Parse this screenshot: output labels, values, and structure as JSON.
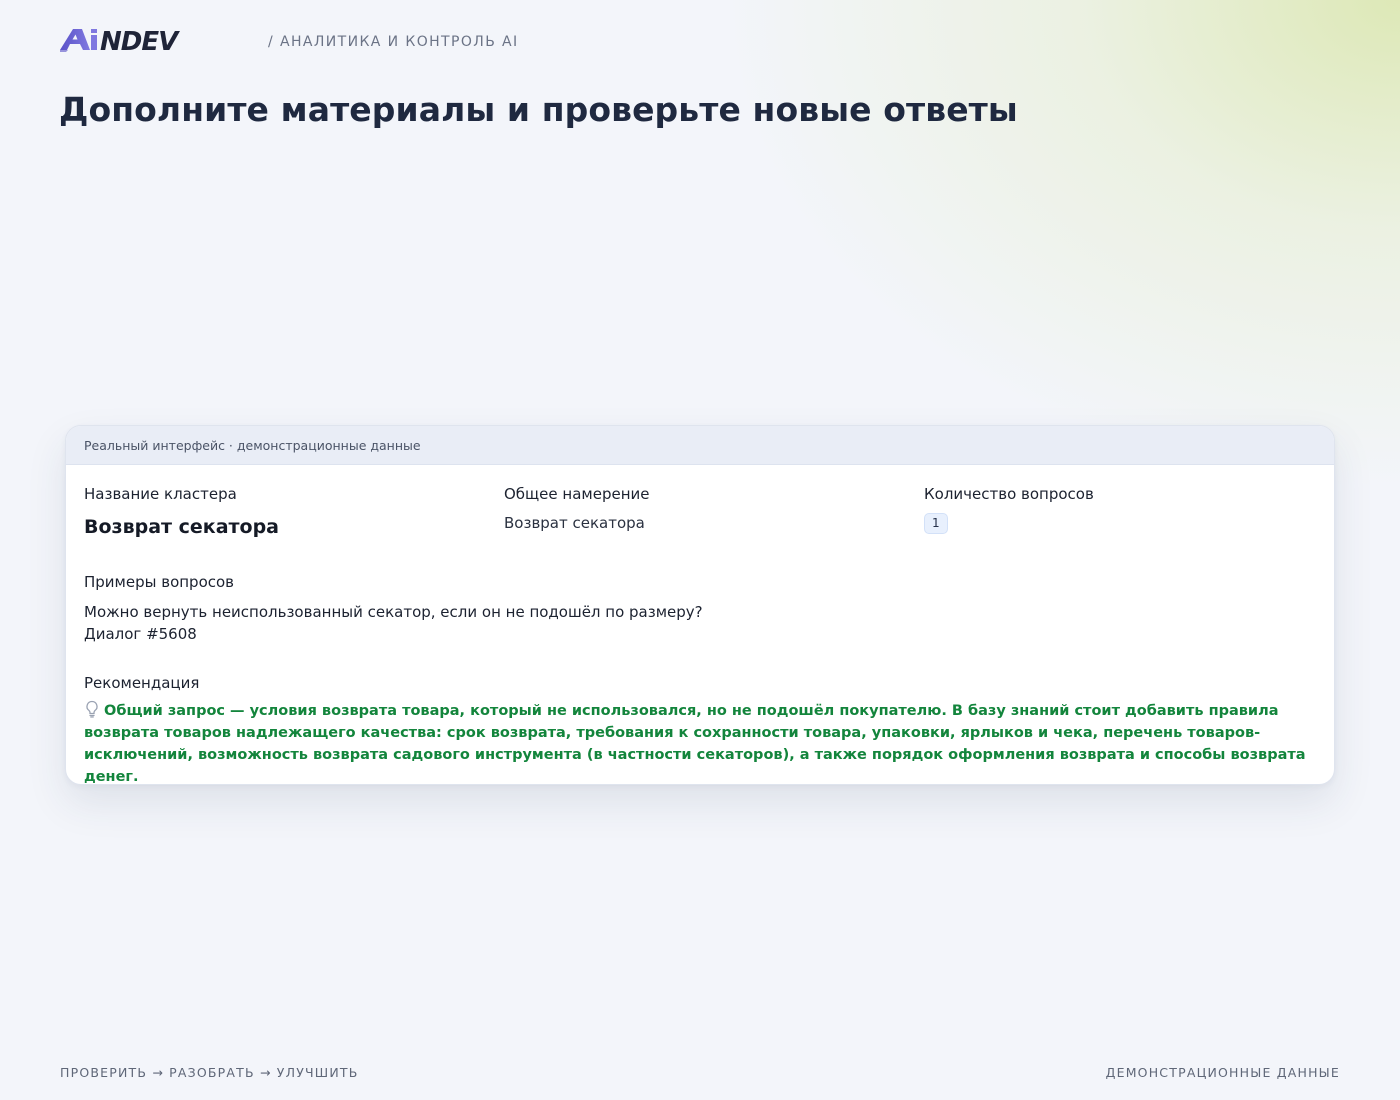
{
  "brand": {
    "logo_text": "AiNDEV",
    "subtitle": "/ АНАЛИТИКА И КОНТРОЛЬ AI"
  },
  "page": {
    "title": "Дополните материалы и проверьте новые ответы"
  },
  "card": {
    "header_note": "Реальный интерфейс · демонстрационные данные",
    "cluster": {
      "label": "Название кластера",
      "value": "Возврат секатора"
    },
    "intent": {
      "label": "Общее намерение",
      "value": "Возврат секатора"
    },
    "questions_count": {
      "label": "Количество вопросов",
      "value": "1"
    },
    "examples": {
      "label": "Примеры вопросов",
      "items": [
        {
          "question": "Можно вернуть неиспользованный секатор, если он не подошёл по размеру?",
          "dialog": "Диалог #5608"
        }
      ]
    },
    "recommendation": {
      "label": "Рекомендация",
      "icon": "lightbulb-icon",
      "text": "Общий запрос — условия возврата товара, который не использовался, но не подошёл покупателю. В базу знаний стоит добавить правила возврата товаров надлежащего качества: срок возврата, требования к сохранности товара, упаковки, ярлыков и чека, перечень товаров-исключений, возможность возврата садового инструмента (в частности секаторов), а также порядок оформления возврата и способы возврата денег.",
      "color": "#13853c"
    }
  },
  "footer": {
    "left": "ПРОВЕРИТЬ → РАЗОБРАТЬ → УЛУЧШИТЬ",
    "right": "ДЕМОНСТРАЦИОННЫЕ ДАННЫЕ"
  },
  "colors": {
    "title": "#1f2940",
    "logo_accent": "#6a63d6",
    "logo_dark": "#1f2438",
    "background": "#f3f5fa"
  }
}
